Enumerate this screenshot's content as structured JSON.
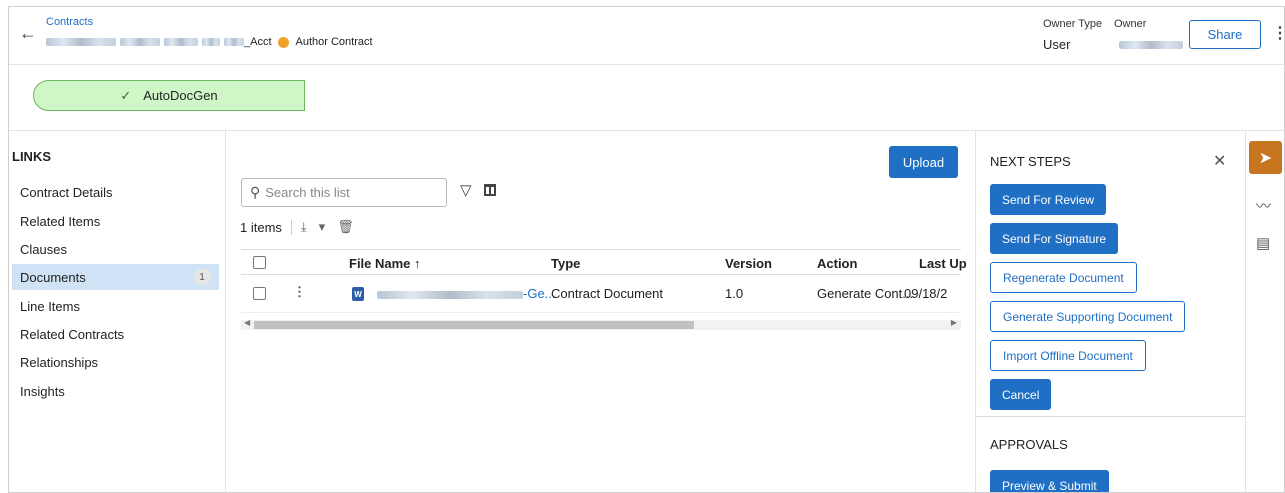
{
  "header": {
    "breadcrumb": "Contracts",
    "title_suffix": "_Acct",
    "status": "Author Contract",
    "owner_type_label": "Owner Type",
    "owner_label": "Owner",
    "owner_type_value": "User",
    "share_label": "Share"
  },
  "stage": {
    "label": "AutoDocGen"
  },
  "links": {
    "title": "LINKS",
    "items": [
      {
        "label": "Contract Details"
      },
      {
        "label": "Related Items"
      },
      {
        "label": "Clauses"
      },
      {
        "label": "Documents",
        "badge": "1"
      },
      {
        "label": "Line Items"
      },
      {
        "label": "Related Contracts"
      },
      {
        "label": "Relationships"
      },
      {
        "label": "Insights"
      }
    ]
  },
  "documents": {
    "upload_label": "Upload",
    "search_placeholder": "Search this list",
    "item_count": "1 items",
    "columns": {
      "file_name": "File Name ↑",
      "type": "Type",
      "version": "Version",
      "action": "Action",
      "last_updated": "Last Up"
    },
    "rows": [
      {
        "file_name_suffix": "-Ge...",
        "type": "Contract Document",
        "version": "1.0",
        "action": "Generate Cont...",
        "last_updated": "09/18/2"
      }
    ]
  },
  "next_steps": {
    "title": "NEXT STEPS",
    "buttons": {
      "send_review": "Send For Review",
      "send_signature": "Send For Signature",
      "regenerate": "Regenerate Document",
      "generate_supporting": "Generate Supporting Document",
      "import_offline": "Import Offline Document",
      "cancel": "Cancel"
    },
    "approvals_title": "APPROVALS",
    "preview_submit": "Preview & Submit"
  },
  "colors": {
    "primary": "#1f6fc5",
    "stage_fill": "#cff6c6",
    "status_dot": "#f0a22b",
    "rail_active": "#c7751f"
  }
}
